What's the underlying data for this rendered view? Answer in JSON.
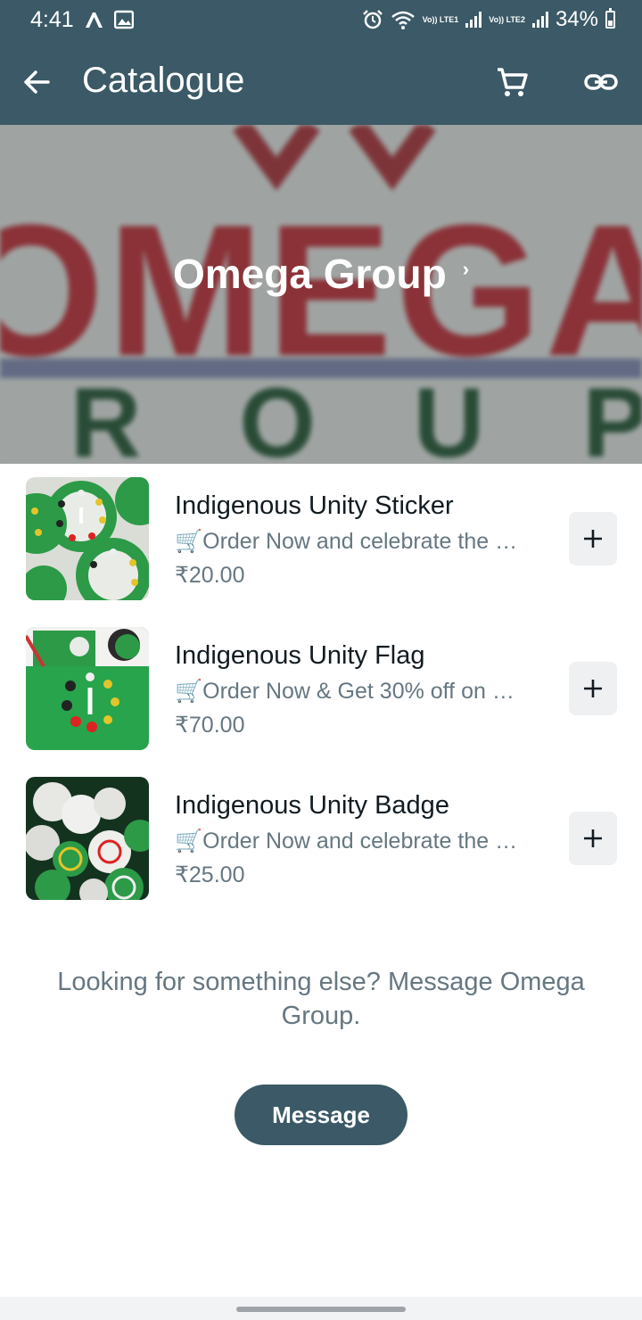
{
  "status_bar": {
    "time": "4:41",
    "sim1": "Vo)) LTE1",
    "sim2": "Vo)) LTE2",
    "battery": "34%"
  },
  "app_bar": {
    "title": "Catalogue",
    "icons": [
      "back-arrow-icon",
      "cart-icon",
      "link-icon"
    ]
  },
  "banner": {
    "business_name": "Omega Group",
    "chevron": "›",
    "art_text_top": "OMEGA",
    "art_text_bottom": "GROUP"
  },
  "products": [
    {
      "name": "Indigenous Unity Sticker",
      "description": "🛒Order Now and celebrate the …",
      "price": "₹20.00"
    },
    {
      "name": "Indigenous Unity Flag",
      "description": "🛒Order Now & Get 30% off on …",
      "price": "₹70.00"
    },
    {
      "name": "Indigenous Unity Badge",
      "description": "🛒Order Now and celebrate the …",
      "price": "₹25.00"
    }
  ],
  "footer": {
    "prompt": "Looking for something else? Message Omega Group.",
    "message_button": "Message"
  },
  "colors": {
    "header": "#3b5966",
    "secondary_text": "#667781",
    "button_bg": "#3b5966"
  }
}
